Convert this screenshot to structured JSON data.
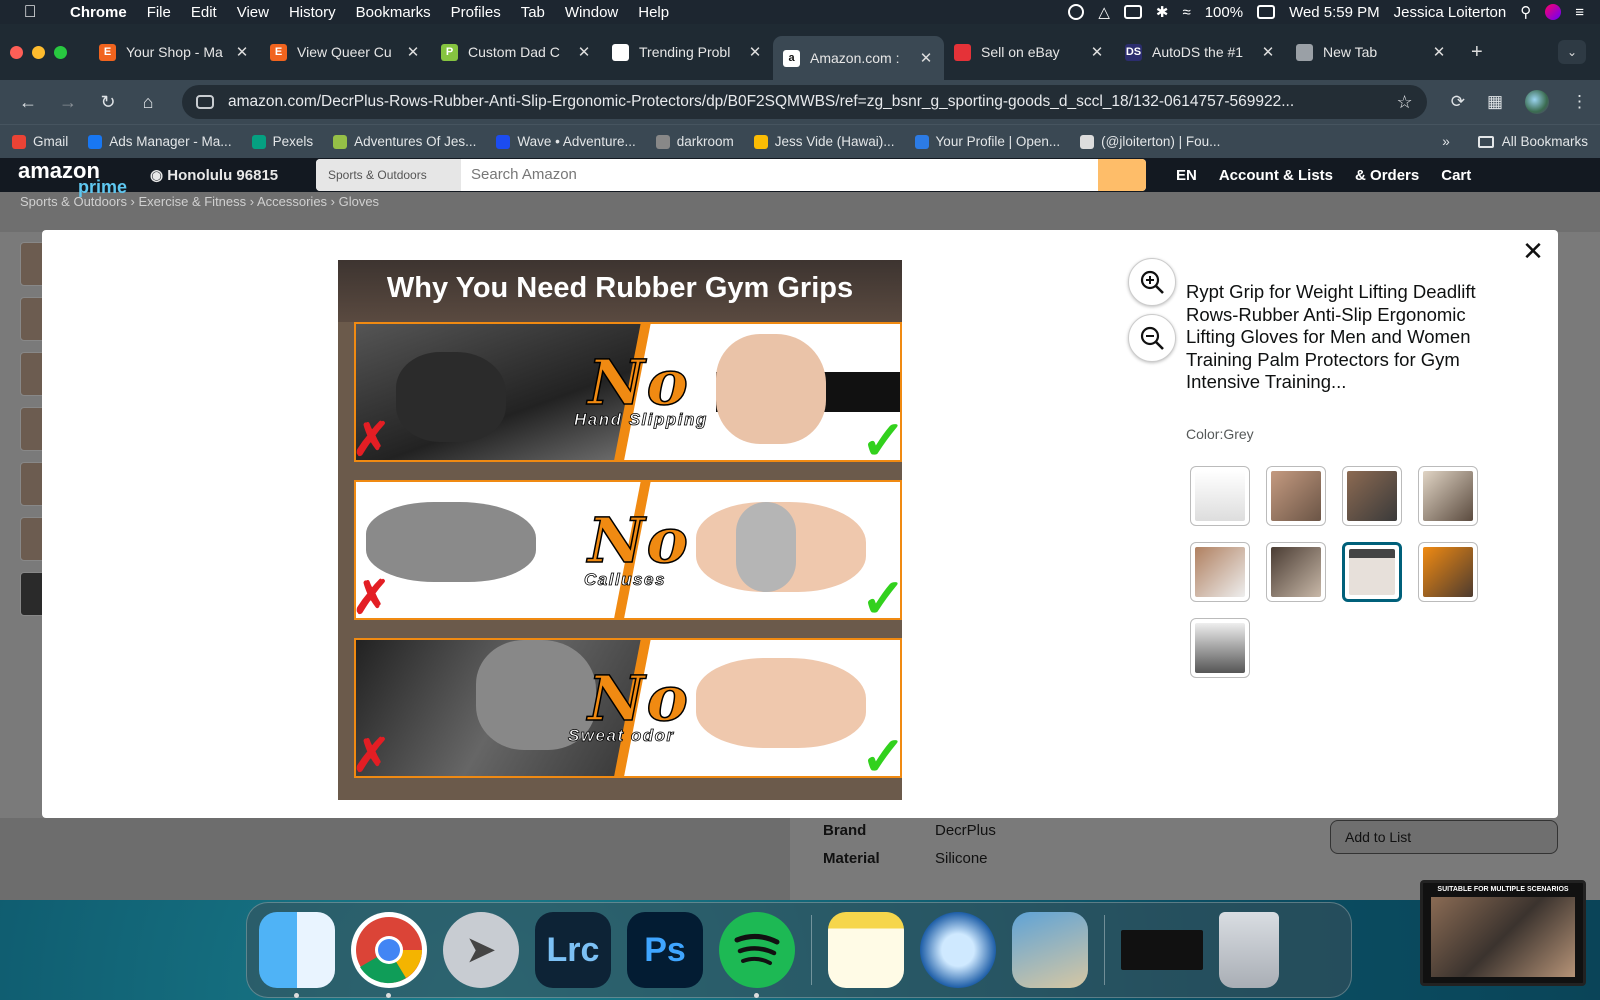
{
  "menubar": {
    "app_name": "Chrome",
    "menus": [
      "File",
      "Edit",
      "View",
      "History",
      "Bookmarks",
      "Profiles",
      "Tab",
      "Window",
      "Help"
    ],
    "battery": "100%",
    "datetime": "Wed 5:59 PM",
    "user": "Jessica Loiterton"
  },
  "browser": {
    "tabs": [
      {
        "title": "Your Shop - Ma",
        "fav_color": "#f1641e",
        "fav_letter": "E"
      },
      {
        "title": "View Queer Cu",
        "fav_color": "#f1641e",
        "fav_letter": "E"
      },
      {
        "title": "Custom Dad C",
        "fav_color": "#86c440",
        "fav_letter": "P"
      },
      {
        "title": "Trending Probl",
        "fav_color": "#ffffff",
        "fav_letter": ""
      },
      {
        "title": "Amazon.com :",
        "fav_color": "#ffffff",
        "fav_letter": "a"
      },
      {
        "title": "Sell on eBay",
        "fav_color": "#e53238",
        "fav_letter": ""
      },
      {
        "title": "AutoDS the #1",
        "fav_color": "#2b2d6e",
        "fav_letter": "DS"
      },
      {
        "title": "New Tab",
        "fav_color": "#9aa0a6",
        "fav_letter": ""
      }
    ],
    "active_tab_index": 4,
    "url": "amazon.com/DecrPlus-Rows-Rubber-Anti-Slip-Ergonomic-Protectors/dp/B0F2SQMWBS/ref=zg_bsnr_g_sporting-goods_d_sccl_18/132-0614757-569922...",
    "bookmarks": [
      {
        "label": "Gmail",
        "color": "#ea4335"
      },
      {
        "label": "Ads Manager - Ma...",
        "color": "#1877f2"
      },
      {
        "label": "Pexels",
        "color": "#05a081"
      },
      {
        "label": "Adventures Of Jes...",
        "color": "#95bf47"
      },
      {
        "label": "Wave • Adventure...",
        "color": "#1c4cf0"
      },
      {
        "label": "darkroom",
        "color": "#888888"
      },
      {
        "label": "Jess Vide (Hawai)...",
        "color": "#fbbc04"
      },
      {
        "label": "Your Profile | Open...",
        "color": "#2c7be5"
      },
      {
        "label": "(@jloiterton) | Fou...",
        "color": "#dddddd"
      }
    ],
    "all_bookmarks": "All Bookmarks"
  },
  "amazon": {
    "deliver_to": "Honolulu 96815",
    "search_category": "Sports & Outdoors",
    "search_placeholder": "Search Amazon",
    "language": "EN",
    "account": "Account & Lists",
    "orders": "& Orders",
    "cart": "Cart",
    "breadcrumb": "Sports & Outdoors › Exercise & Fitness › Accessories › Gloves",
    "specs": [
      {
        "label": "Brand",
        "value": "DecrPlus"
      },
      {
        "label": "Material",
        "value": "Silicone"
      }
    ],
    "add_to_list": "Add to List"
  },
  "modal": {
    "title": "Rypt Grip for Weight Lifting Deadlift Rows-Rubber Anti-Slip Ergonomic Lifting Gloves for Men and Women Training Palm Protectors for Gym Intensive Training...",
    "color_label": "Color:Grey",
    "selected_thumb": 6,
    "thumb_count": 9,
    "hero_image": {
      "headline": "Why You Need Rubber Gym Grips",
      "no_word": "No",
      "panels": [
        "Hand Slipping",
        "Calluses",
        "Sweat odor"
      ]
    }
  },
  "dock": {
    "apps": [
      "Finder",
      "Chrome",
      "Launchpad",
      "Lrc",
      "Ps",
      "Spotify",
      "Notes",
      "QuickTime",
      "Preview",
      "Spotify Mini",
      "Trash"
    ]
  },
  "pip": {
    "label": "SUITABLE FOR MULTIPLE SCENARIOS"
  }
}
